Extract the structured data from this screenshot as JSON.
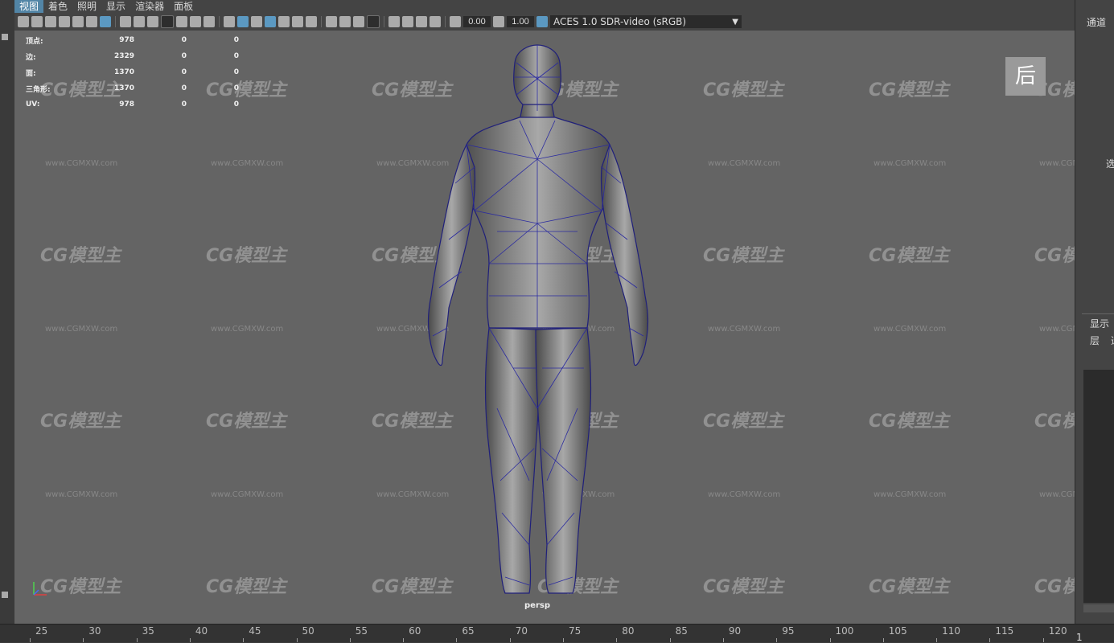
{
  "menu": [
    "视图",
    "着色",
    "照明",
    "显示",
    "渲染器",
    "面板"
  ],
  "toolbar": {
    "exposure": "0.00",
    "gamma": "1.00",
    "color_space": "ACES 1.0 SDR-video (sRGB)"
  },
  "hud": {
    "rows": [
      {
        "label": "顶点:",
        "v1": "978",
        "v2": "0",
        "v3": "0"
      },
      {
        "label": "边:",
        "v1": "2329",
        "v2": "0",
        "v3": "0"
      },
      {
        "label": "面:",
        "v1": "1370",
        "v2": "0",
        "v3": "0"
      },
      {
        "label": "三角形:",
        "v1": "1370",
        "v2": "0",
        "v3": "0"
      },
      {
        "label": "UV:",
        "v1": "978",
        "v2": "0",
        "v3": "0"
      }
    ]
  },
  "viewport": {
    "camera": "persp",
    "view_cube": "后"
  },
  "watermark": {
    "logo": "CG模型主",
    "url": "www.CGMXW.com"
  },
  "right_panel": {
    "channel": "通道",
    "select_fragment": "选",
    "display": "显示",
    "layer": "层",
    "layer_opt": "选"
  },
  "timeline": {
    "ticks": [
      "25",
      "30",
      "35",
      "40",
      "45",
      "50",
      "55",
      "60",
      "65",
      "70",
      "75",
      "80",
      "85",
      "90",
      "95",
      "100",
      "105",
      "110",
      "115",
      "120"
    ],
    "current_frame": "1"
  }
}
